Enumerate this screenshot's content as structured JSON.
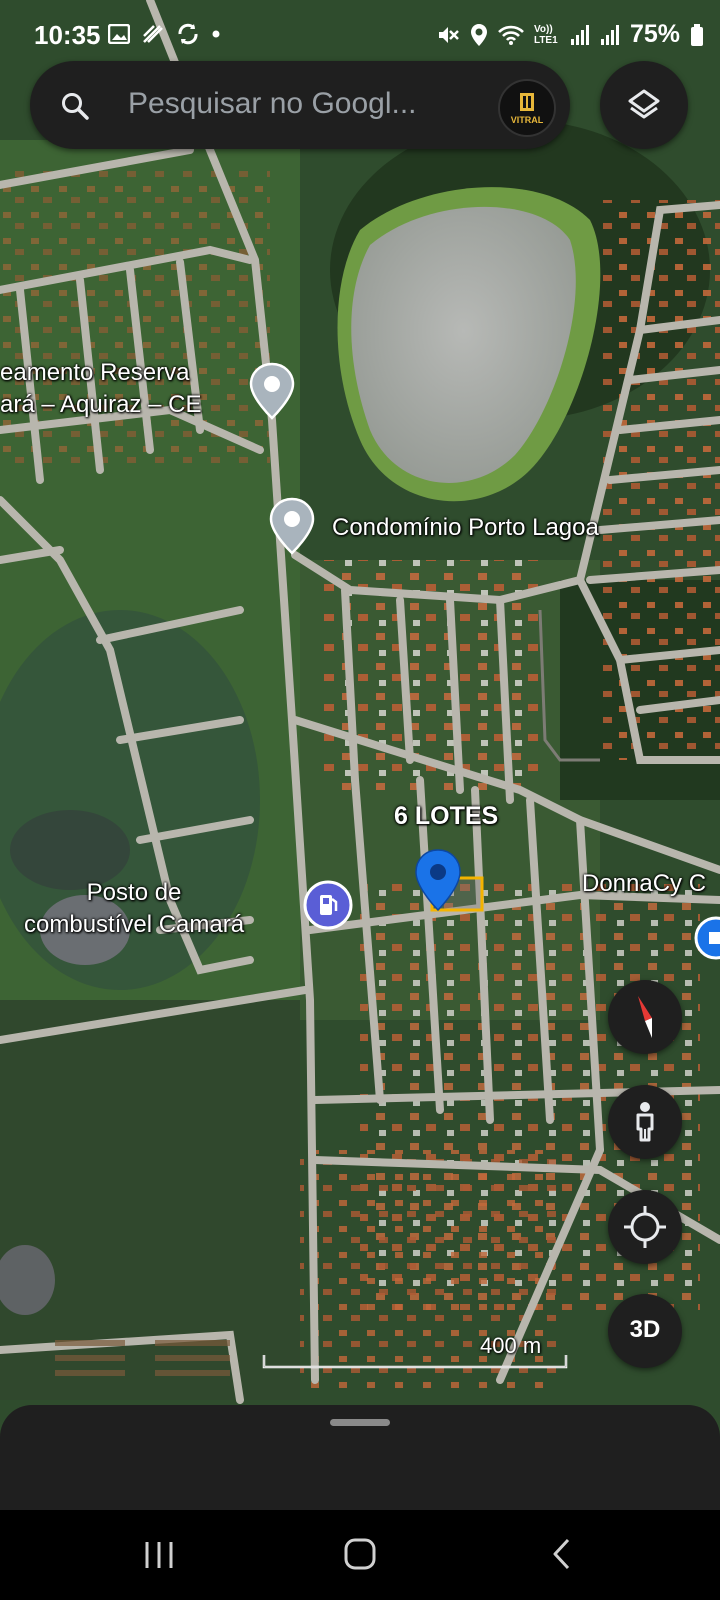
{
  "status_bar": {
    "time": "10:35",
    "battery": "75%",
    "network": "Vo)) LTE1"
  },
  "search": {
    "placeholder": "Pesquisar no Googl..."
  },
  "avatar": {
    "label": "VITRAL"
  },
  "map": {
    "labels": {
      "loteamento": [
        "eamento Reserva",
        "ará – Aquiraz – CE"
      ],
      "condominio": "Condomínio Porto Lagoa",
      "lotes": "6 LOTES",
      "posto": [
        "Posto de",
        "combustível Camará"
      ],
      "donnacy": "DonnaCy C"
    },
    "scale": "400 m"
  },
  "controls": {
    "three_d": "3D"
  },
  "colors": {
    "selected_pin": "#1a73e8",
    "gas_pin": "#5a5ed6",
    "place_pin": "#a9b4bd",
    "plot_outline": "#f4b400",
    "compass_red": "#e53935"
  }
}
